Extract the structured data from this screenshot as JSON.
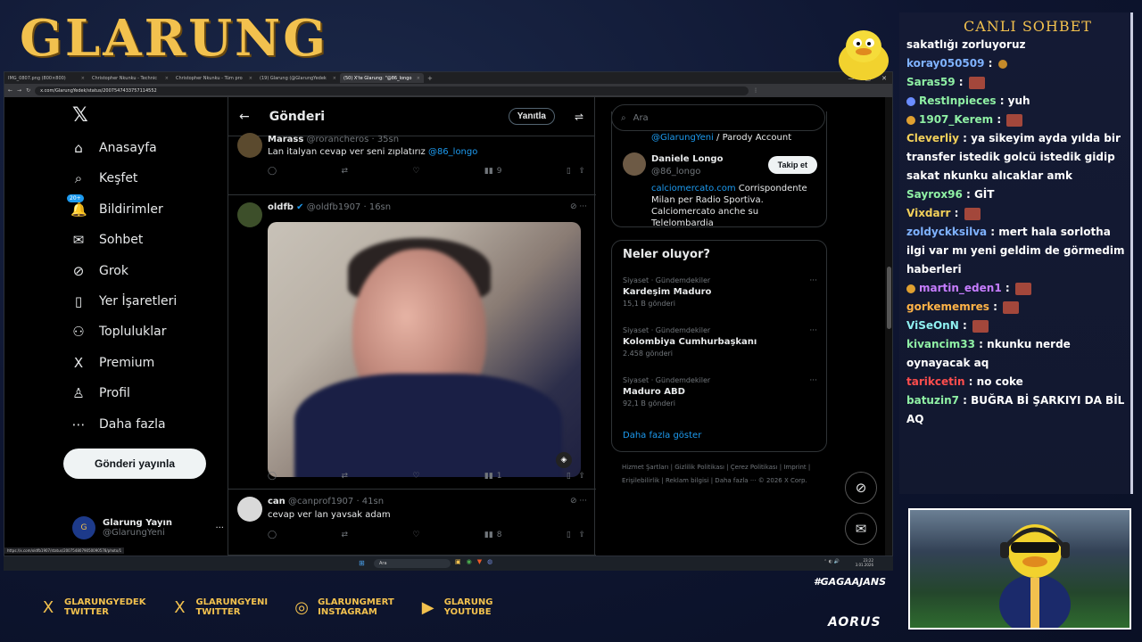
{
  "stream": {
    "brand": "GLARUNG",
    "chat_title": "CANLI SOHBET",
    "hashtag": "#GAGAAJANS",
    "sponsor": "AORUS",
    "socials": [
      {
        "icon": "x-icon",
        "line1": "GLARUNGYEDEK",
        "line2": "TWITTER"
      },
      {
        "icon": "x-icon",
        "line1": "GLARUNGYENI",
        "line2": "TWITTER"
      },
      {
        "icon": "instagram-icon",
        "line1": "GLARUNGMERT",
        "line2": "INSTAGRAM"
      },
      {
        "icon": "youtube-icon",
        "line1": "GLARUNG",
        "line2": "YOUTUBE"
      }
    ]
  },
  "browser": {
    "tabs": [
      {
        "label": "IMG_0807.png (800×800)",
        "active": false
      },
      {
        "label": "Christopher Nkunku - Technic",
        "active": false
      },
      {
        "label": "Christopher Nkunku - Tüm pro",
        "active": false
      },
      {
        "label": "(19) Glarung (@GlarungYedek",
        "active": false
      },
      {
        "label": "(50) X'te Glarung: \"@86_longo",
        "active": true
      }
    ],
    "url": "x.com/GlarungYedek/status/2007547433757114552",
    "status_url": "https://x.com/oldfb1907/status/2007548079050090578/photo/1"
  },
  "nav": {
    "items": [
      {
        "icon": "home-icon",
        "glyph": "⌂",
        "label": "Anasayfa"
      },
      {
        "icon": "search-icon",
        "glyph": "⌕",
        "label": "Keşfet"
      },
      {
        "icon": "bell-icon",
        "glyph": "🔔",
        "label": "Bildirimler",
        "badge": "20+"
      },
      {
        "icon": "mail-icon",
        "glyph": "✉",
        "label": "Sohbet"
      },
      {
        "icon": "grok-icon",
        "glyph": "⊘",
        "label": "Grok"
      },
      {
        "icon": "bookmark-icon",
        "glyph": "▯",
        "label": "Yer İşaretleri"
      },
      {
        "icon": "communities-icon",
        "glyph": "⚇",
        "label": "Topluluklar"
      },
      {
        "icon": "x-premium-icon",
        "glyph": "X",
        "label": "Premium"
      },
      {
        "icon": "profile-icon",
        "glyph": "♙",
        "label": "Profil"
      },
      {
        "icon": "more-icon",
        "glyph": "⋯",
        "label": "Daha fazla"
      }
    ],
    "post_button": "Gönderi yayınla",
    "account": {
      "name": "Glarung Yayın",
      "handle": "@GlarungYeni"
    }
  },
  "main": {
    "title": "Gönderi",
    "reply_button": "Yanıtla",
    "tweets": [
      {
        "name": "Marass",
        "meta": "@rorancheros · 35sn",
        "text": "Lan italyan cevap ver seni zıplatırız",
        "mention": "@86_longo",
        "views": "9"
      },
      {
        "name": "oldfb",
        "meta": "@oldfb1907 · 16sn",
        "text": "",
        "mention": "",
        "views": "1"
      },
      {
        "name": "can",
        "meta": "@canprof1907 · 41sn",
        "text": "cevap ver lan yavsak adam",
        "mention": "",
        "views": "8"
      }
    ]
  },
  "right": {
    "search_placeholder": "Ara",
    "top_handle": "@GlarungYeni",
    "top_suffix": " / Parody Account",
    "who": {
      "name": "Daniele Longo",
      "handle": "@86_longo",
      "follow": "Takip et",
      "bio_link": "calciomercato.com",
      "bio_rest": " Corrispondente Milan per Radio Sportiva. Calciomercato anche su Telelombardia"
    },
    "trends_title": "Neler oluyor?",
    "trends": [
      {
        "category": "Siyaset · Gündemdekiler",
        "name": "Kardeşim Maduro",
        "count": "15,1 B gönderi"
      },
      {
        "category": "Siyaset · Gündemdekiler",
        "name": "Kolombiya Cumhurbaşkanı",
        "count": "2.458 gönderi"
      },
      {
        "category": "Siyaset · Gündemdekiler",
        "name": "Maduro ABD",
        "count": "92,1 B gönderi"
      }
    ],
    "show_more": "Daha fazla göster",
    "footer": "Hizmet Şartları  |  Gizlilik Politikası  |  Çerez Politikası  |  Imprint  |  Erişilebilirlik  |  Reklam bilgisi  |  Daha fazla ···  © 2026 X Corp."
  },
  "taskbar": {
    "search": "Ara",
    "time": "23:22",
    "date": "3.01.2026"
  },
  "chat": [
    {
      "user": "",
      "text": "sakatlığı zorluyoruz",
      "color": "#ffffff",
      "emote": false
    },
    {
      "user": "koray050509",
      "text": " : ",
      "color": "#7fb2ff",
      "emote": "small"
    },
    {
      "user": "Saras59",
      "text": " : ",
      "color": "#8ff0a4",
      "emote": true
    },
    {
      "user": "RestInpieces",
      "text": " : yuh",
      "color": "#8ff0a4",
      "emote": false,
      "dot": "#6a8cff"
    },
    {
      "user": "1907_Kerem",
      "text": " : ",
      "color": "#8ff0a4",
      "emote": true,
      "dot": "#e0a030"
    },
    {
      "user": "Cleverliy",
      "text": " : ya sikeyim ayda yılda bir transfer istedik golcü istedik gidip sakat nkunku alıcaklar amk",
      "color": "#f2d05a",
      "emote": false
    },
    {
      "user": "Sayrox96",
      "text": " : GİT",
      "color": "#8ff0a4",
      "emote": false
    },
    {
      "user": "Vixdarr",
      "text": " : ",
      "color": "#f2d05a",
      "emote": true
    },
    {
      "user": "zoldyckksilva",
      "text": " : mert hala sorlotha ilgi var mı yeni geldim de görmedim haberleri",
      "color": "#7fb2ff",
      "emote": false
    },
    {
      "user": "martin_eden1",
      "text": " : ",
      "color": "#c77dff",
      "emote": true,
      "dot": "#e0a030"
    },
    {
      "user": "gorkememres",
      "text": " : ",
      "color": "#ffb347",
      "emote": true
    },
    {
      "user": "ViSeOnN",
      "text": " : ",
      "color": "#8ff0f0",
      "emote": true
    },
    {
      "user": "kivancim33",
      "text": " : nkunku nerde oynayacak aq",
      "color": "#8ff0a4",
      "emote": false
    },
    {
      "user": "tarikcetin",
      "text": " : no coke",
      "color": "#ff4d4d",
      "emote": false
    },
    {
      "user": "batuzin7",
      "text": " : BUĞRA Bİ ŞARKIYI DA BİL AQ",
      "color": "#8ff0a4",
      "emote": false
    }
  ]
}
